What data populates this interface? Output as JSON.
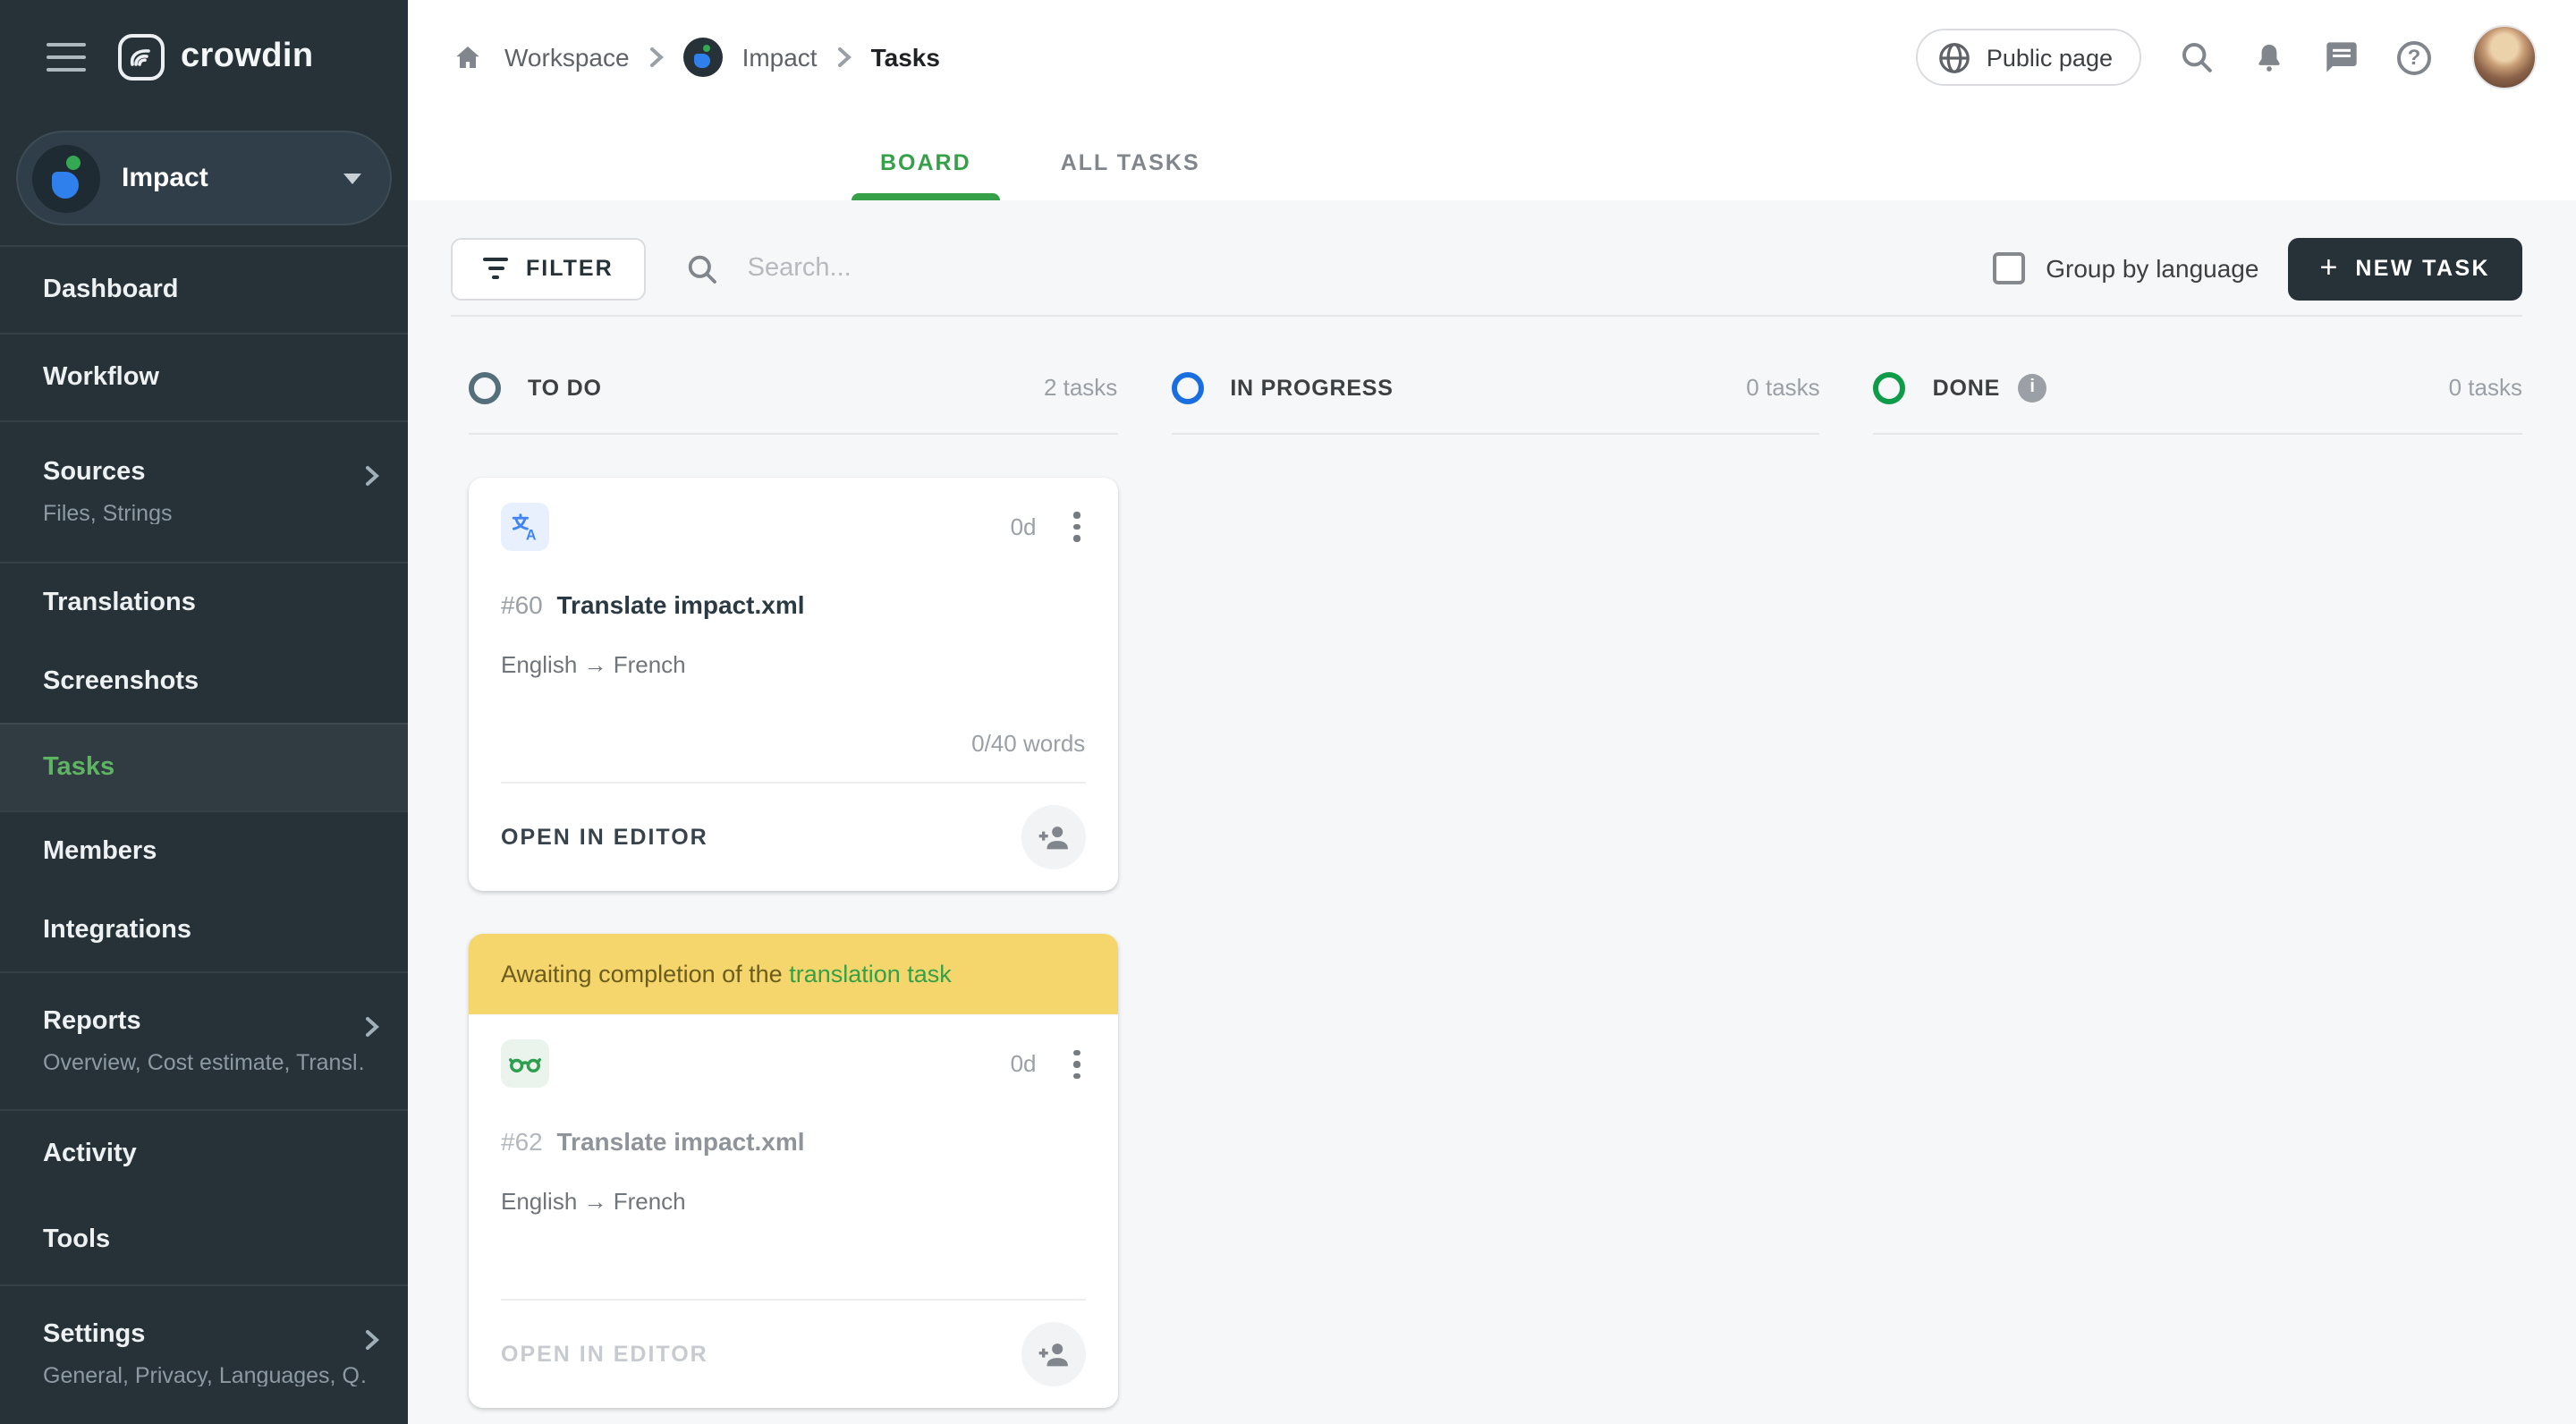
{
  "app": {
    "brand": "crowdin"
  },
  "sidebar": {
    "project": {
      "name": "Impact"
    },
    "items": [
      {
        "label": "Dashboard"
      },
      {
        "label": "Workflow"
      },
      {
        "label": "Sources",
        "subtitle": "Files, Strings"
      },
      {
        "label": "Translations"
      },
      {
        "label": "Screenshots"
      },
      {
        "label": "Tasks"
      },
      {
        "label": "Members"
      },
      {
        "label": "Integrations"
      },
      {
        "label": "Reports",
        "subtitle": "Overview, Cost estimate, Transl…"
      },
      {
        "label": "Activity"
      },
      {
        "label": "Tools"
      },
      {
        "label": "Settings",
        "subtitle": "General, Privacy, Languages, Q…"
      }
    ]
  },
  "header": {
    "breadcrumb": {
      "workspace": "Workspace",
      "project": "Impact",
      "page": "Tasks"
    },
    "public_page_label": "Public page"
  },
  "tabs": [
    {
      "label": "BOARD"
    },
    {
      "label": "ALL TASKS"
    }
  ],
  "toolbar": {
    "filter_label": "FILTER",
    "search_placeholder": "Search...",
    "group_by_language_label": "Group by language",
    "new_task_plus": "+",
    "new_task_label": "NEW TASK"
  },
  "board": {
    "columns": [
      {
        "name": "TO DO",
        "count": "2 tasks",
        "color": "#546E7A"
      },
      {
        "name": "IN PROGRESS",
        "count": "0 tasks",
        "color": "#1A6FE0"
      },
      {
        "name": "DONE",
        "count": "0 tasks",
        "color": "#0F9C49",
        "info": "i"
      }
    ],
    "cards": [
      {
        "id": "#60",
        "title": "Translate impact.xml",
        "languages": "English → French",
        "due": "0d",
        "words": "0/40 words",
        "action": "OPEN IN EDITOR"
      },
      {
        "id": "#62",
        "title": "Translate impact.xml",
        "languages": "English → French",
        "due": "0d",
        "action": "OPEN IN EDITOR",
        "banner": {
          "text": "Awaiting completion of the ",
          "link": "translation task"
        }
      }
    ]
  },
  "colors": {
    "accent_green": "#35A048",
    "banner_yellow": "#F5D66C",
    "sidebar_dark": "#263238",
    "todo_ring": "#546E7A",
    "in_progress_ring": "#1A6FE0",
    "done_ring": "#0F9C49"
  }
}
